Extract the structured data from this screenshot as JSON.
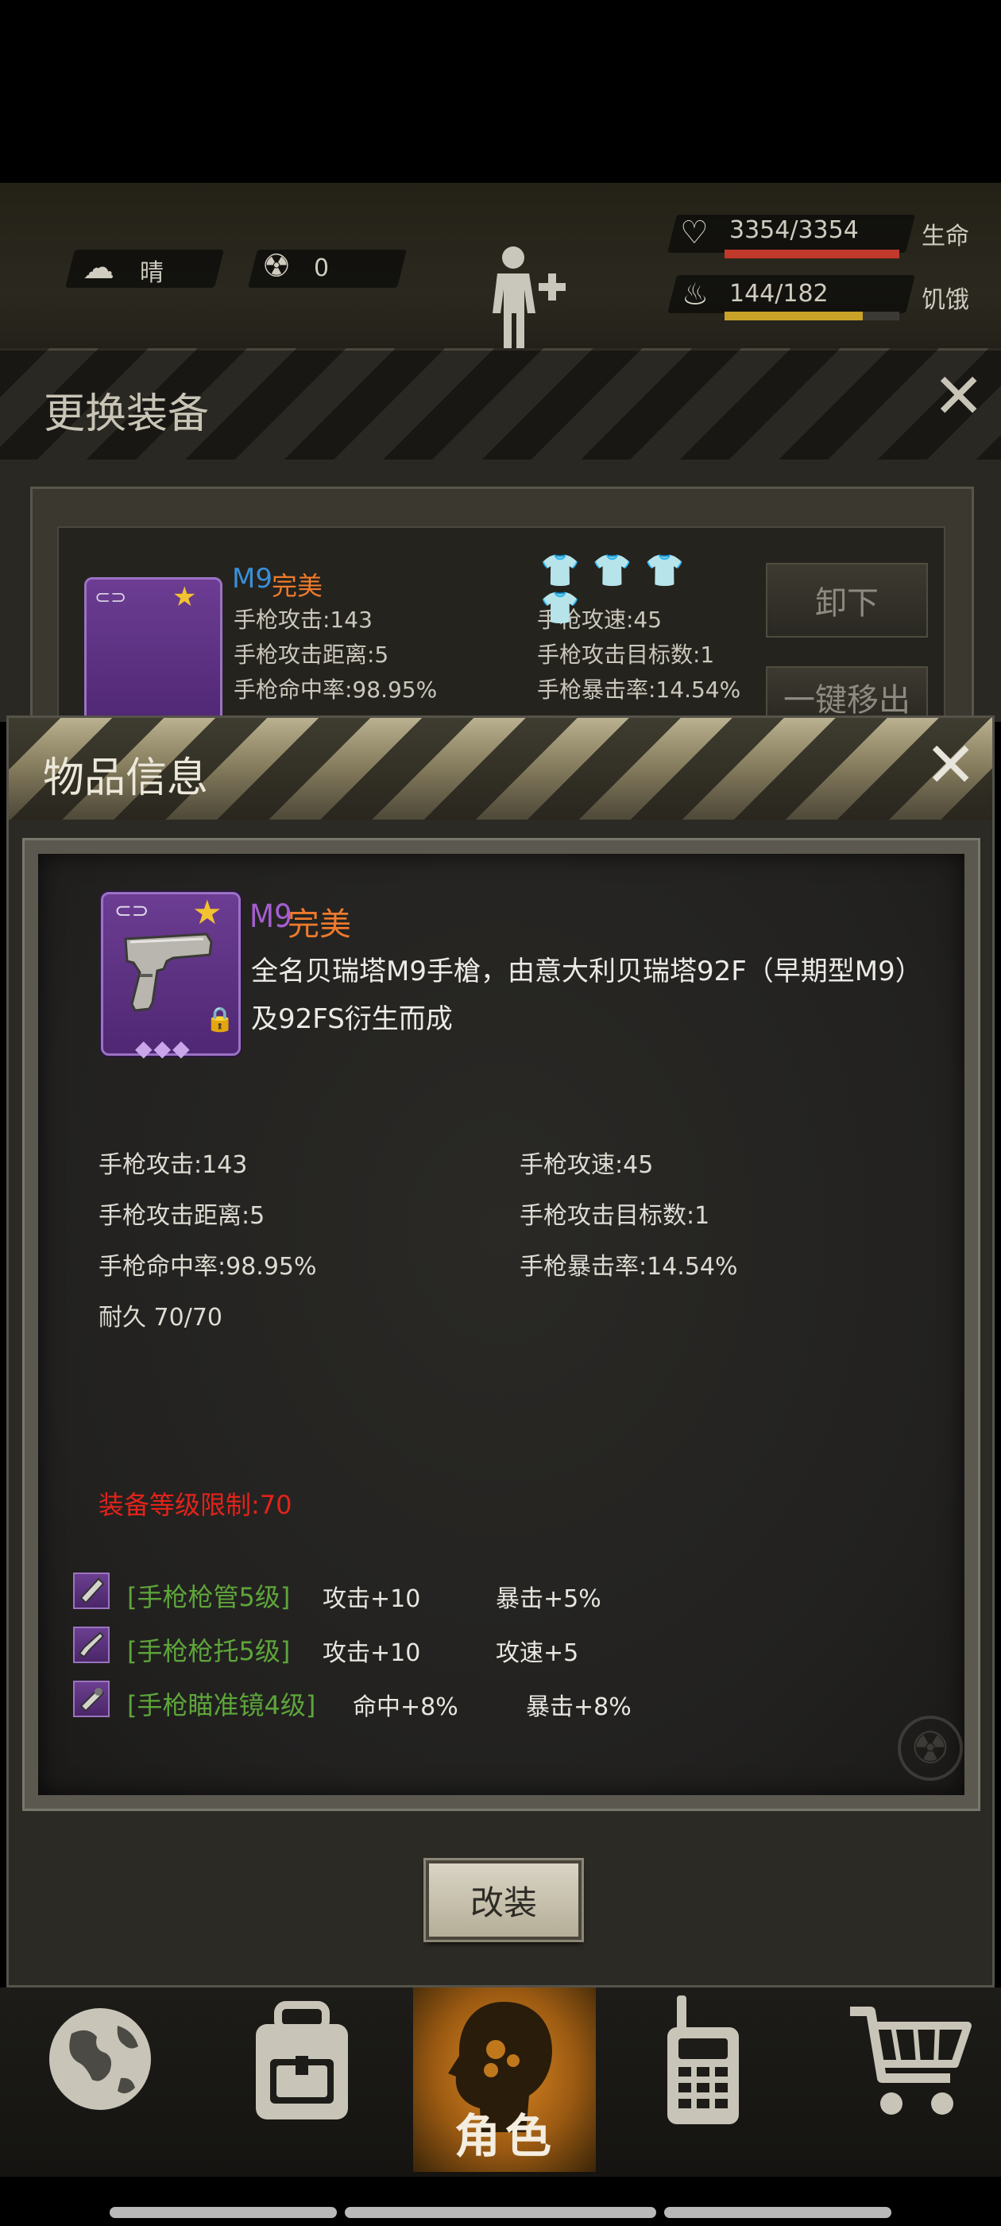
{
  "hud": {
    "weather_label": "晴",
    "radiation_value": "0",
    "health_value": "3354/3354",
    "health_label": "生命",
    "health_fraction": 1.0,
    "hunger_value": "144/182",
    "hunger_label": "饥饿",
    "hunger_fraction": 0.79
  },
  "change_equipment": {
    "title": "更换装备",
    "item_name": "M9",
    "item_quality": "完美",
    "stats": [
      "手枪攻击:143",
      "手枪攻速:45",
      "手枪攻击距离:5",
      "手枪攻击目标数:1",
      "手枪命中率:98.95%",
      "手枪暴击率:14.54%"
    ],
    "unequip_label": "卸下",
    "remove_all_label": "一键移出"
  },
  "item_info": {
    "title": "物品信息",
    "item_name": "M9",
    "item_quality": "完美",
    "description_line1": "全名贝瑞塔M9手槍，由意大利贝瑞塔92F（早期型M9）",
    "description_line2": "及92FS衍生而成",
    "stats": [
      "手枪攻击:143",
      "手枪攻速:45",
      "手枪攻击距离:5",
      "手枪攻击目标数:1",
      "手枪命中率:98.95%",
      "手枪暴击率:14.54%"
    ],
    "durability": "耐久 70/70",
    "level_requirement": "装备等级限制:70",
    "mods": [
      {
        "name": "[手枪枪管5级]",
        "effect1": "攻击+10",
        "effect2": "暴击+5%"
      },
      {
        "name": "[手枪枪托5级]",
        "effect1": "攻击+10",
        "effect2": "攻速+5"
      },
      {
        "name": "[手枪瞄准镜4级]",
        "effect1": "命中+8%",
        "effect2": "暴击+8%"
      }
    ],
    "modify_button": "改装",
    "rarity_diamonds": 3
  },
  "nav": {
    "active_label": "角色",
    "items": [
      "globe-icon",
      "backpack-icon",
      "character-icon",
      "radio-icon",
      "cart-icon"
    ]
  },
  "colors": {
    "quality_orange": "#ef7a2c",
    "name_purple": "#a45ed0",
    "mod_green": "#5ea53a",
    "requirement_red": "#e2231a",
    "health_red": "#c0392b",
    "hunger_yellow": "#c9a227"
  }
}
